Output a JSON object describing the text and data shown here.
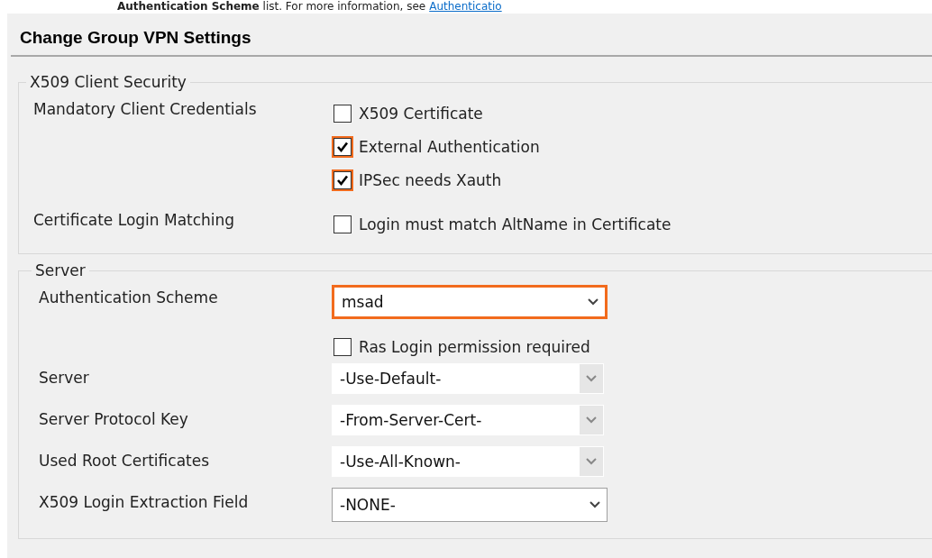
{
  "intro": {
    "text": "**Authentication Scheme** list. For more information, see",
    "link": "Authenticatio"
  },
  "dialog": {
    "title": "Change Group VPN Settings"
  },
  "groups": [
    {
      "title": "X509 Client Security",
      "rows": [
        {
          "kind": "checks",
          "label": "Mandatory Client Credentials",
          "options": [
            {
              "label": "X509 Certificate",
              "checked": false,
              "highlighted": false
            },
            {
              "label": "External Authentication",
              "checked": true,
              "highlighted": true
            },
            {
              "label": "IPSec needs Xauth",
              "checked": true,
              "highlighted": true
            }
          ]
        },
        {
          "kind": "checks",
          "label": "Certificate Login Matching",
          "options": [
            {
              "label": "Login must match AltName in Certificate",
              "checked": false,
              "highlighted": false
            }
          ]
        }
      ]
    },
    {
      "title": "Server",
      "rows": [
        {
          "kind": "select",
          "label": "Authentication Scheme",
          "value": "msad",
          "highlighted": true,
          "disabled": false
        },
        {
          "kind": "checks",
          "options": [
            {
              "label": "Ras Login permission required",
              "checked": false,
              "highlighted": false
            }
          ]
        },
        {
          "kind": "select",
          "label": "Server",
          "value": "-Use-Default-",
          "highlighted": false,
          "disabled": true
        },
        {
          "kind": "select",
          "label": "Server Protocol Key",
          "value": "-From-Server-Cert-",
          "highlighted": false,
          "disabled": true
        },
        {
          "kind": "select",
          "label": "Used Root Certificates",
          "value": "-Use-All-Known-",
          "highlighted": false,
          "disabled": true
        },
        {
          "kind": "select",
          "label": "X509 Login Extraction Field",
          "value": "-NONE-",
          "highlighted": false,
          "disabled": false
        }
      ]
    }
  ]
}
